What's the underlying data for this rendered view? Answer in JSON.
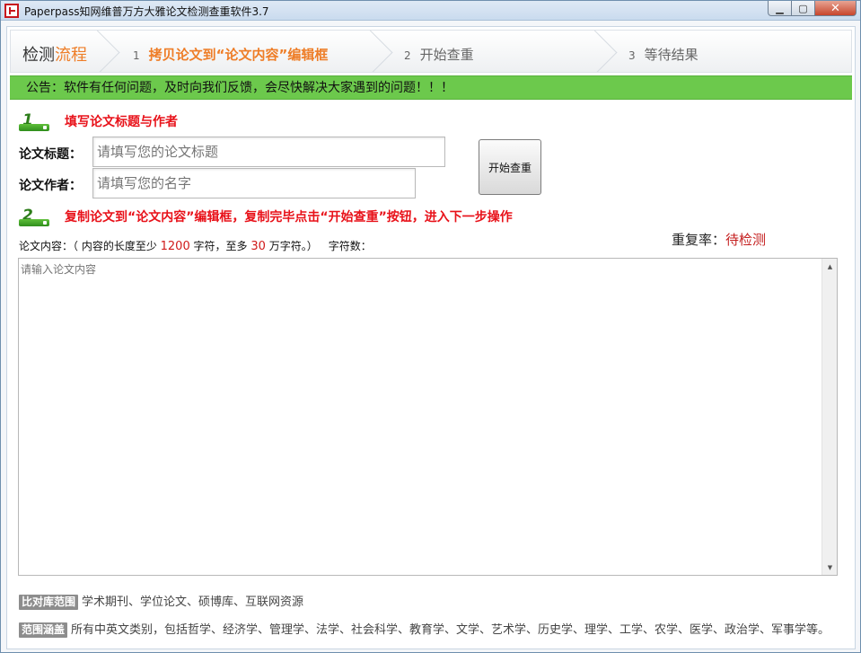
{
  "window": {
    "title": "Paperpass知网维普万方大雅论文检测查重软件3.7",
    "minimize_glyph": "▁",
    "maximize_glyph": "▢",
    "close_glyph": "✕"
  },
  "steps": {
    "title_plain": "检测",
    "title_accent": "流程",
    "items": [
      {
        "num": "1",
        "label": "拷贝论文到“论文内容”编辑框",
        "active": true
      },
      {
        "num": "2",
        "label": "开始查重",
        "active": false
      },
      {
        "num": "3",
        "label": "等待结果",
        "active": false
      }
    ]
  },
  "notice": "公告：软件有任何问题，及时向我们反馈，会尽快解决大家遇到的问题！！！",
  "section1": {
    "badge": "1",
    "heading": "填写论文标题与作者",
    "title_label": "论文标题：",
    "title_placeholder": "请填写您的论文标题",
    "author_label": "论文作者：",
    "author_placeholder": "请填写您的名字"
  },
  "start_button": "开始查重",
  "section2": {
    "badge": "2",
    "heading": "复制论文到“论文内容”编辑框，复制完毕点击“开始查重”按钮，进入下一步操作"
  },
  "rate": {
    "label": "重复率：",
    "value": "待检测"
  },
  "content_hint": {
    "prefix": "论文内容：（ 内容的长度至少 ",
    "min": "1200",
    "middle": " 字符，至多 ",
    "max": "30",
    "suffix": " 万字符。）",
    "count_label": "字符数："
  },
  "content": {
    "placeholder": "请输入论文内容"
  },
  "footer": {
    "compare_tag": "比对库范围",
    "compare_text": "学术期刊、学位论文、硕博库、互联网资源",
    "scope_tag": "范围涵盖",
    "scope_text": "所有中英文类别，包括哲学、经济学、管理学、法学、社会科学、教育学、文学、艺术学、历史学、理学、工学、农学、医学、政治学、军事学等。"
  },
  "colors": {
    "accent_orange": "#ee7d27",
    "notice_green": "#6cc94c",
    "heading_red": "#e8121a"
  }
}
